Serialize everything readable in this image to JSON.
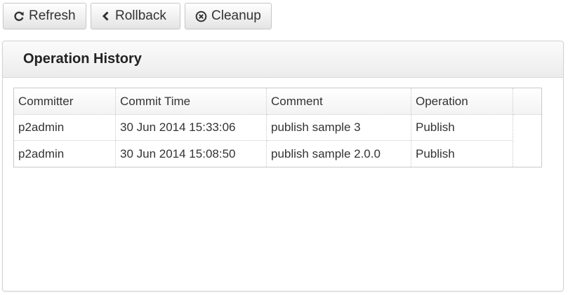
{
  "toolbar": {
    "refresh": {
      "label": "Refresh",
      "icon": "refresh-icon"
    },
    "rollback": {
      "label": "Rollback",
      "icon": "chevron-left-icon"
    },
    "cleanup": {
      "label": "Cleanup",
      "icon": "circle-x-icon"
    }
  },
  "panel": {
    "title": "Operation History"
  },
  "table": {
    "columns": [
      "Committer",
      "Commit Time",
      "Comment",
      "Operation"
    ],
    "rows": [
      [
        "p2admin",
        "30 Jun 2014 15:33:06",
        "publish sample 3",
        "Publish"
      ],
      [
        "p2admin",
        "30 Jun 2014 15:08:50",
        "publish sample 2.0.0",
        "Publish"
      ]
    ]
  }
}
